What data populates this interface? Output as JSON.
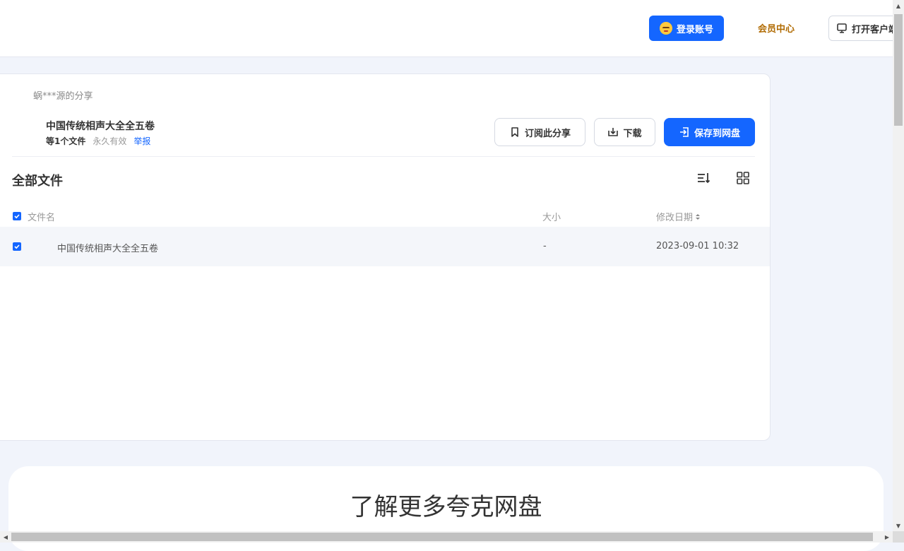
{
  "header": {
    "login_label": "登录账号",
    "member_label": "会员中心",
    "client_label": "打开客户端"
  },
  "share": {
    "sharer": "蜗***源的分享",
    "title": "中国传统相声大全全五卷",
    "file_count": "等1个文件",
    "validity": "永久有效",
    "report": "举报",
    "subscribe_label": "订阅此分享",
    "download_label": "下载",
    "save_label": "保存到网盘"
  },
  "files": {
    "heading": "全部文件",
    "columns": {
      "name": "文件名",
      "size": "大小",
      "modified": "修改日期"
    },
    "rows": [
      {
        "name": "中国传统相声大全全五卷",
        "size": "-",
        "modified": "2023-09-01 10:32",
        "checked": true
      }
    ]
  },
  "promo": {
    "title": "了解更多夸克网盘"
  },
  "colors": {
    "accent": "#1466ff",
    "member": "#b06a00"
  }
}
